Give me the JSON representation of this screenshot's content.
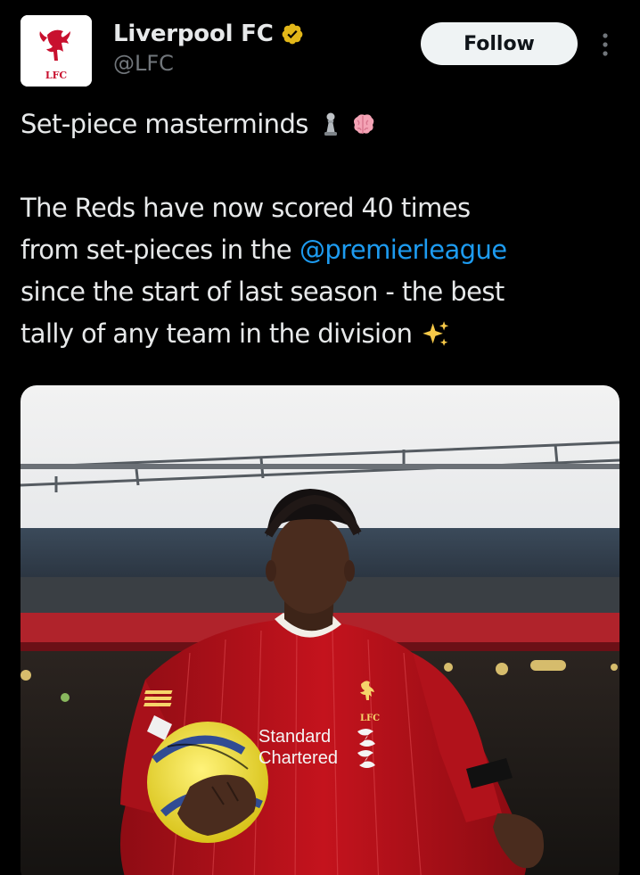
{
  "author": {
    "display_name": "Liverpool FC",
    "handle": "@LFC",
    "avatar_icon": "lfc-crest-icon",
    "avatar_text": "LFC",
    "verified_badge_color": "#e2b719"
  },
  "actions": {
    "follow_label": "Follow",
    "more_icon": "more-vertical-icon"
  },
  "tweet": {
    "line1": "Set-piece masterminds",
    "line1_emojis": [
      "chess-pawn-emoji",
      "brain-emoji"
    ],
    "line2": "The Reds have now scored 40 times",
    "line3_prefix": "from set-pieces in the",
    "mention": "@premierleague",
    "line4": "since the start of last season - the best",
    "line5": "tally of any team in the division",
    "line5_emoji": "sparkles-emoji"
  },
  "media": {
    "kit_badge_text": "LFC",
    "sponsor_line1": "Standard",
    "sponsor_line2": "Chartered"
  },
  "colors": {
    "background": "#000000",
    "text": "#e7e9ea",
    "secondary_text": "#71767b",
    "link": "#1d9bf0",
    "follow_bg": "#eff3f4",
    "brand_red": "#c8102e"
  }
}
